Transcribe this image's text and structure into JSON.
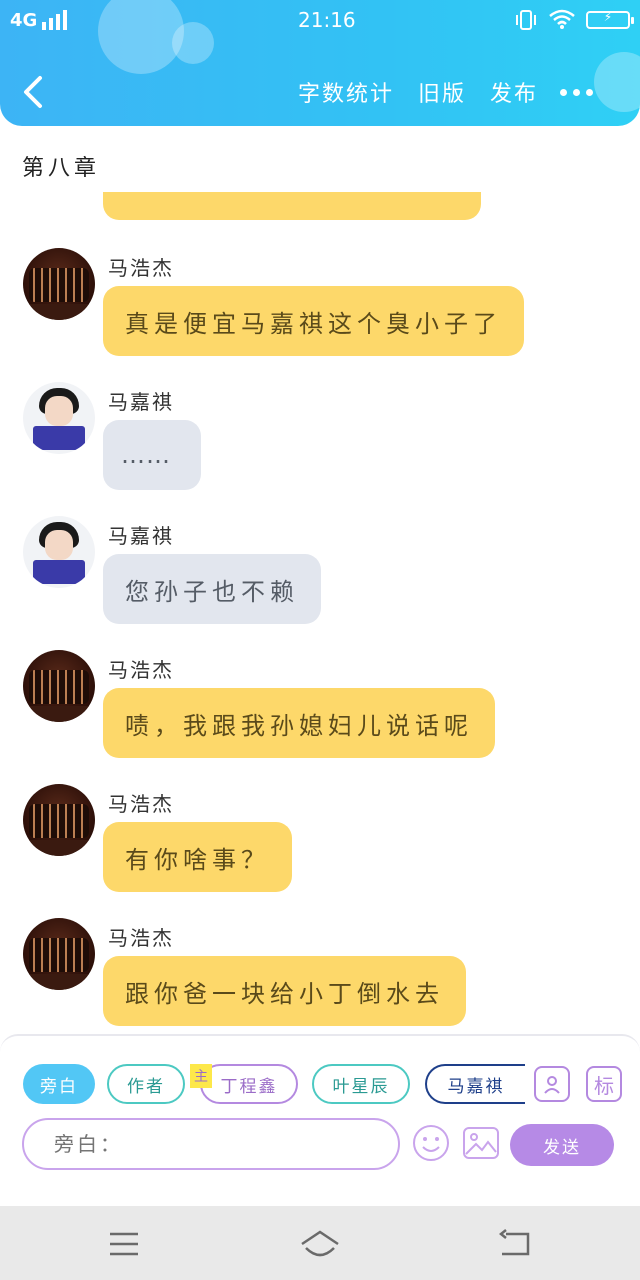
{
  "status_bar": {
    "network": "4G",
    "time": "21:16",
    "icons": [
      "signal-icon",
      "vibrate-icon",
      "wifi-icon",
      "battery-charging-icon"
    ]
  },
  "header": {
    "back_icon": "chevron-left-icon",
    "actions": [
      "字数统计",
      "旧版",
      "发布"
    ],
    "more_icon": "more-horizontal-icon",
    "colors": {
      "gradient_start": "#3db4f5",
      "gradient_end": "#2fd0f5"
    }
  },
  "chapter": {
    "title": "第八章"
  },
  "messages": [
    {
      "sender": "马浩杰",
      "avatar": "group-photo-avatar",
      "text": "真是便宜马嘉祺这个臭小子了",
      "style": "yellow"
    },
    {
      "sender": "马嘉祺",
      "avatar": "boy-with-book-avatar",
      "text": "……",
      "style": "gray"
    },
    {
      "sender": "马嘉祺",
      "avatar": "boy-with-book-avatar",
      "text": "您孙子也不赖",
      "style": "gray"
    },
    {
      "sender": "马浩杰",
      "avatar": "group-photo-avatar",
      "text": "啧，我跟我孙媳妇儿说话呢",
      "style": "yellow"
    },
    {
      "sender": "马浩杰",
      "avatar": "group-photo-avatar",
      "text": "有你啥事？",
      "style": "yellow"
    },
    {
      "sender": "马浩杰",
      "avatar": "group-photo-avatar",
      "text": "跟你爸一块给小丁倒水去",
      "style": "yellow"
    }
  ],
  "input_panel": {
    "roles": [
      {
        "label": "旁白",
        "selected": true
      },
      {
        "label": "作者"
      },
      {
        "label": "丁程鑫",
        "tag": "主"
      },
      {
        "label": "叶星辰"
      },
      {
        "label": "马嘉祺"
      }
    ],
    "contact_icon": "person-card-icon",
    "mark_label": "标",
    "input_placeholder": "旁白：",
    "emoji_icon": "smiley-icon",
    "image_icon": "image-icon",
    "send_label": "发送",
    "colors": {
      "bubble_yellow": "#fdd86a",
      "bubble_gray": "#e2e6ee",
      "send": "#b68ae6",
      "narrator": "#52c7f5"
    }
  },
  "system_nav": {
    "icons": [
      "menu-icon",
      "home-icon",
      "back-icon"
    ]
  }
}
